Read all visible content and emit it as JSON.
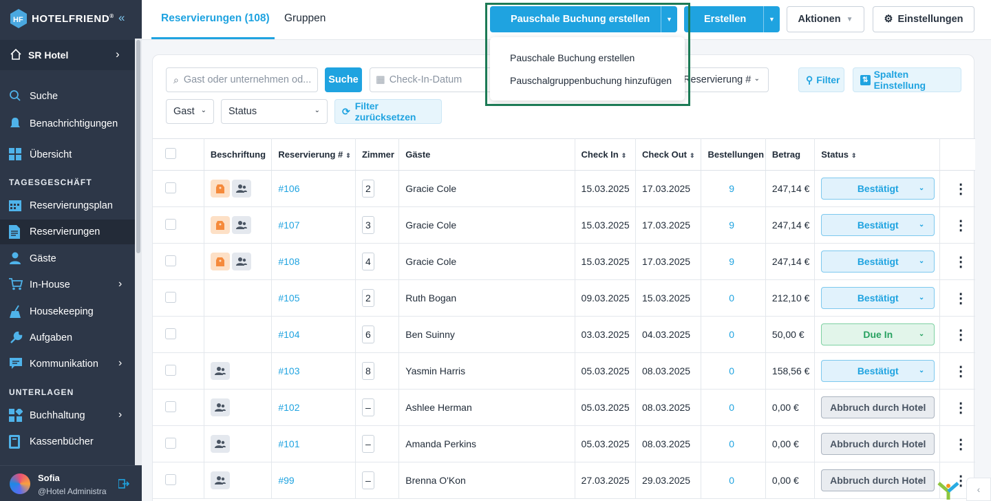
{
  "brand": {
    "name": "HOTELFRIEND",
    "reg": "®"
  },
  "sidebar": {
    "hotel": "SR Hotel",
    "items_top": [
      {
        "label": "Suche",
        "icon": "search-icon"
      },
      {
        "label": "Benachrichtigungen",
        "icon": "bell-icon"
      },
      {
        "label": "Übersicht",
        "icon": "dashboard-icon"
      }
    ],
    "section1": "TAGESGESCHÄFT",
    "items_daily": [
      {
        "label": "Reservierungsplan",
        "icon": "calendar-icon"
      },
      {
        "label": "Reservierungen",
        "icon": "document-icon",
        "active": true
      },
      {
        "label": "Gäste",
        "icon": "person-icon"
      },
      {
        "label": "In-House",
        "icon": "cart-icon",
        "chevron": true
      },
      {
        "label": "Housekeeping",
        "icon": "broom-icon"
      },
      {
        "label": "Aufgaben",
        "icon": "wrench-icon"
      },
      {
        "label": "Kommunikation",
        "icon": "chat-icon",
        "chevron": true
      }
    ],
    "section2": "UNTERLAGEN",
    "items_docs": [
      {
        "label": "Buchhaltung",
        "icon": "accounting-icon",
        "chevron": true
      },
      {
        "label": "Kassenbücher",
        "icon": "book-icon"
      }
    ],
    "user": {
      "name": "Sofia",
      "role": "@Hotel Administrator"
    }
  },
  "tabs": [
    "Reservierungen (108)",
    "Gruppen"
  ],
  "toolbar": {
    "package_booking": "Pauschale Buchung erstellen",
    "create": "Erstellen",
    "actions": "Aktionen",
    "settings": "Einstellungen"
  },
  "dropdown": {
    "options": [
      "Pauschale Buchung erstellen",
      "Pauschalgruppenbuchung hinzufügen"
    ]
  },
  "filters": {
    "search_placeholder": "Gast oder unternehmen od...",
    "search_button": "Suche",
    "checkin_placeholder": "Check-In-Datum",
    "reservation_select": "Reservierung #",
    "filter_button": "Filter",
    "columns_button": "Spalten Einstellung",
    "guest_select": "Gast",
    "status_select": "Status",
    "reset_button": "Filter zurücksetzen"
  },
  "table": {
    "headers": [
      "Beschriftung",
      "Reservierung #",
      "Zimmer",
      "Gäste",
      "Check In",
      "Check Out",
      "Bestellungen",
      "Betrag",
      "Status"
    ],
    "rows": [
      {
        "tags": [
          "orange",
          "gray"
        ],
        "res": "#106",
        "room": "2",
        "guest": "Gracie Cole",
        "in": "15.03.2025",
        "out": "17.03.2025",
        "orders": "9",
        "amount": "247,14 €",
        "status": "Bestätigt",
        "st": "confirmed"
      },
      {
        "tags": [
          "orange",
          "gray"
        ],
        "res": "#107",
        "room": "3",
        "guest": "Gracie Cole",
        "in": "15.03.2025",
        "out": "17.03.2025",
        "orders": "9",
        "amount": "247,14 €",
        "status": "Bestätigt",
        "st": "confirmed"
      },
      {
        "tags": [
          "orange",
          "gray"
        ],
        "res": "#108",
        "room": "4",
        "guest": "Gracie Cole",
        "in": "15.03.2025",
        "out": "17.03.2025",
        "orders": "9",
        "amount": "247,14 €",
        "status": "Bestätigt",
        "st": "confirmed"
      },
      {
        "tags": [],
        "res": "#105",
        "room": "2",
        "guest": "Ruth Bogan",
        "in": "09.03.2025",
        "out": "15.03.2025",
        "orders": "0",
        "amount": "212,10 €",
        "status": "Bestätigt",
        "st": "confirmed"
      },
      {
        "tags": [],
        "res": "#104",
        "room": "6",
        "guest": "Ben Suinny",
        "in": "03.03.2025",
        "out": "04.03.2025",
        "orders": "0",
        "amount": "50,00 €",
        "status": "Due In",
        "st": "duein"
      },
      {
        "tags": [
          "gray"
        ],
        "res": "#103",
        "room": "8",
        "guest": "Yasmin Harris",
        "in": "05.03.2025",
        "out": "08.03.2025",
        "orders": "0",
        "amount": "158,56 €",
        "status": "Bestätigt",
        "st": "confirmed"
      },
      {
        "tags": [
          "gray"
        ],
        "res": "#102",
        "room": "–",
        "guest": "Ashlee Herman",
        "in": "05.03.2025",
        "out": "08.03.2025",
        "orders": "0",
        "amount": "0,00 €",
        "status": "Abbruch durch Hotel",
        "st": "cancel"
      },
      {
        "tags": [
          "gray"
        ],
        "res": "#101",
        "room": "–",
        "guest": "Amanda Perkins",
        "in": "05.03.2025",
        "out": "08.03.2025",
        "orders": "0",
        "amount": "0,00 €",
        "status": "Abbruch durch Hotel",
        "st": "cancel"
      },
      {
        "tags": [
          "gray"
        ],
        "res": "#99",
        "room": "–",
        "guest": "Brenna O'Kon",
        "in": "27.03.2025",
        "out": "29.03.2025",
        "orders": "0",
        "amount": "0,00 €",
        "status": "Abbruch durch Hotel",
        "st": "cancel"
      }
    ]
  },
  "colors": {
    "accent": "#1fa3e0",
    "sidebar": "#2d3748",
    "highlight": "#1c7a55"
  }
}
